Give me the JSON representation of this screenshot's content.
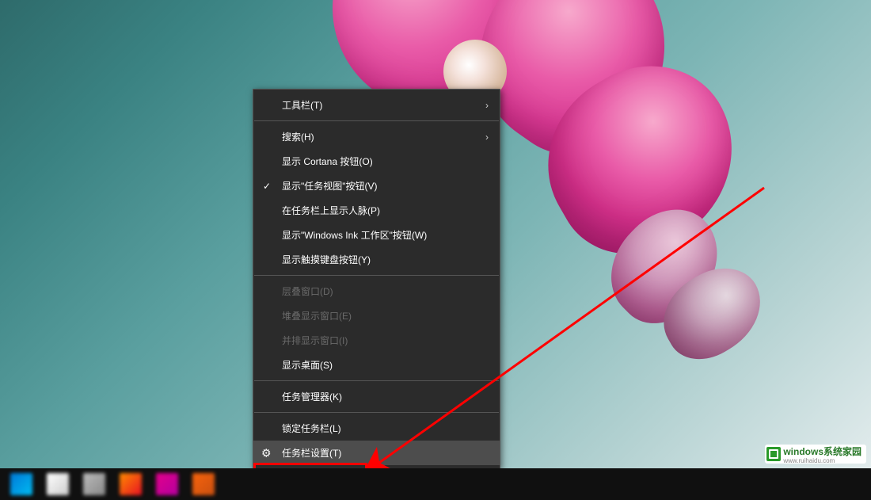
{
  "menu": {
    "toolbars": "工具栏(T)",
    "search": "搜索(H)",
    "show_cortana": "显示 Cortana 按钮(O)",
    "show_taskview": "显示\"任务视图\"按钮(V)",
    "show_people": "在任务栏上显示人脉(P)",
    "show_ink": "显示\"Windows Ink 工作区\"按钮(W)",
    "show_touch_kb": "显示触摸键盘按钮(Y)",
    "cascade": "层叠窗口(D)",
    "stacked": "堆叠显示窗口(E)",
    "sidebyside": "并排显示窗口(I)",
    "show_desktop": "显示桌面(S)",
    "task_manager": "任务管理器(K)",
    "lock_taskbar": "锁定任务栏(L)",
    "taskbar_settings": "任务栏设置(T)"
  },
  "watermark": {
    "main": "windows系统家园",
    "sub": "www.ruihaidu.com"
  },
  "annotation": {
    "color": "#ff0000"
  },
  "taskbar": {
    "icons": [
      {
        "name": "start",
        "color1": "#0078d7",
        "color2": "#00bcf2"
      },
      {
        "name": "search",
        "color1": "#ffffff",
        "color2": "#cccccc"
      },
      {
        "name": "taskview",
        "color1": "#bbbbbb",
        "color2": "#888888"
      },
      {
        "name": "app1",
        "color1": "#ff8c00",
        "color2": "#e81123"
      },
      {
        "name": "app2",
        "color1": "#e3008c",
        "color2": "#b4009e"
      },
      {
        "name": "app3",
        "color1": "#f7630c",
        "color2": "#ca5010"
      }
    ]
  }
}
